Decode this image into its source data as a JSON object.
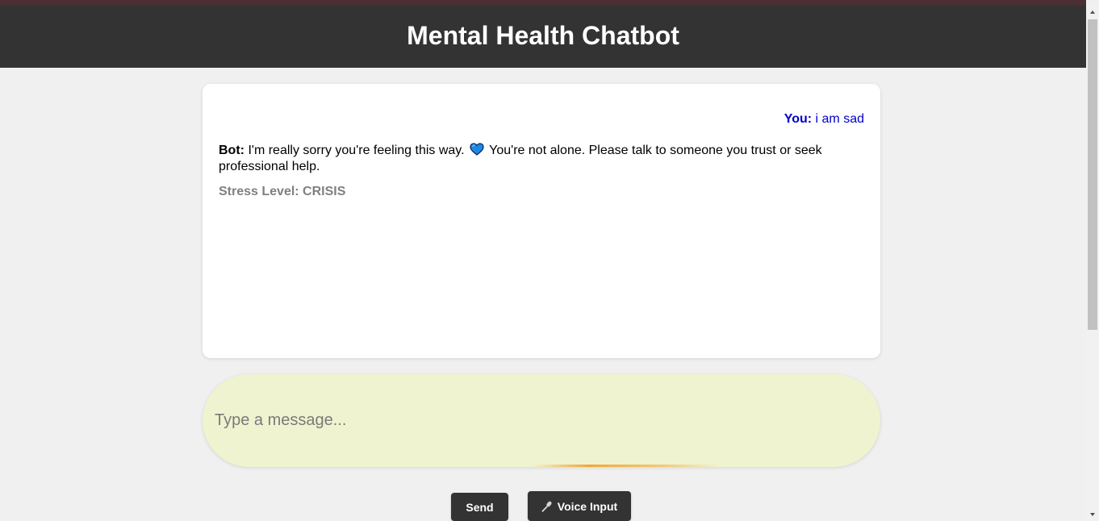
{
  "header": {
    "title": "Mental Health Chatbot"
  },
  "chat": {
    "user_message": {
      "sender": "You:",
      "text": "i am sad"
    },
    "bot_message": {
      "sender": "Bot:",
      "text_before_emoji": "I'm really sorry you're feeling this way.",
      "emoji": "blue-heart-icon",
      "text_after_emoji": "You're not alone. Please talk to someone you trust or seek professional help."
    },
    "stress_level": "Stress Level: CRISIS"
  },
  "input": {
    "placeholder": "Type a message...",
    "value": ""
  },
  "buttons": {
    "send_label": "Send",
    "voice_label": "Voice Input",
    "voice_icon": "microphone-icon"
  },
  "colors": {
    "header_bg": "#333333",
    "page_bg": "#f0f0f0",
    "user_text": "#0000cc",
    "stress_text": "#808080",
    "input_bg": "#f0f3cf",
    "button_bg": "#333333"
  }
}
